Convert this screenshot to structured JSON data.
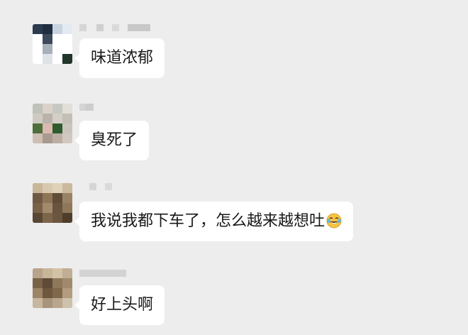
{
  "messages": [
    {
      "text": "味道浓郁",
      "has_emoji": false
    },
    {
      "text": "臭死了",
      "has_emoji": false
    },
    {
      "text": "我说我都下车了，怎么越来越想吐",
      "has_emoji": true,
      "emoji": "crying-laughing-face-icon"
    },
    {
      "text": "好上头啊",
      "has_emoji": false
    }
  ],
  "colors": {
    "background": "#ededed",
    "bubble": "#ffffff",
    "text": "#191919"
  }
}
